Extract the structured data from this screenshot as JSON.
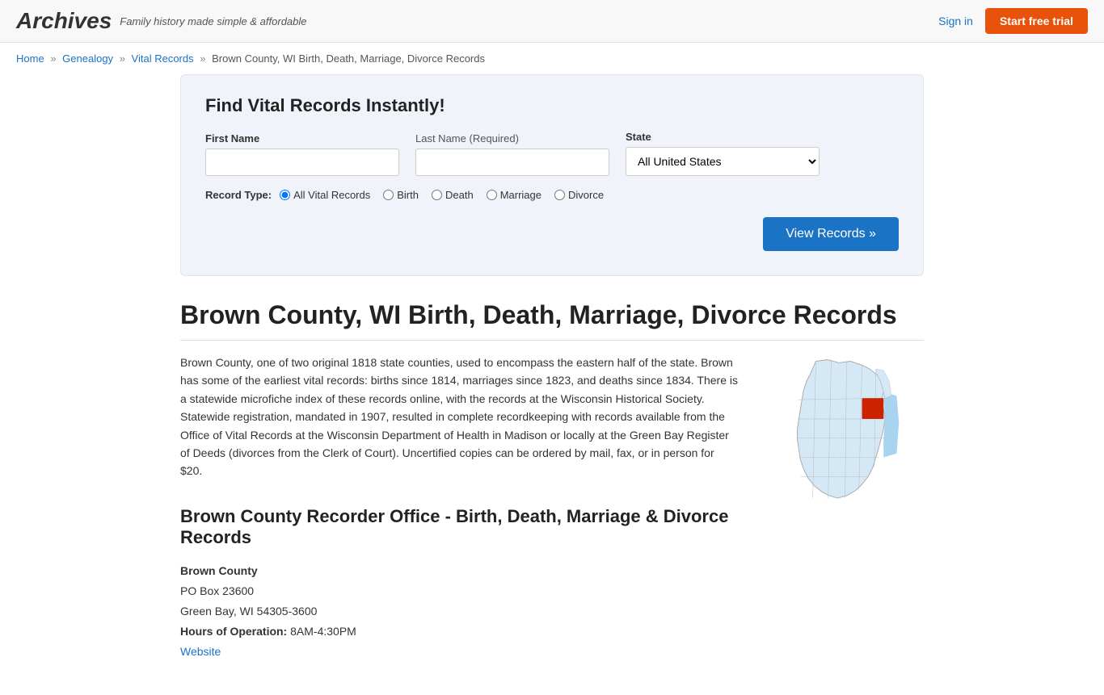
{
  "header": {
    "logo": "Archives",
    "tagline": "Family history made simple & affordable",
    "signin_label": "Sign in",
    "trial_label": "Start free trial"
  },
  "breadcrumb": {
    "home": "Home",
    "genealogy": "Genealogy",
    "vital_records": "Vital Records",
    "current": "Brown County, WI Birth, Death, Marriage, Divorce Records"
  },
  "search": {
    "title": "Find Vital Records Instantly!",
    "first_name_label": "First Name",
    "last_name_label": "Last Name",
    "last_name_required": "(Required)",
    "state_label": "State",
    "state_default": "All United States",
    "first_name_placeholder": "",
    "last_name_placeholder": "",
    "record_type_label": "Record Type:",
    "record_types": [
      "All Vital Records",
      "Birth",
      "Death",
      "Marriage",
      "Divorce"
    ],
    "view_records_btn": "View Records »"
  },
  "page": {
    "title": "Brown County, WI Birth, Death, Marriage, Divorce Records",
    "intro": "Brown County, one of two original 1818 state counties, used to encompass the eastern half of the state. Brown has some of the earliest vital records: births since 1814, marriages since 1823, and deaths since 1834. There is a statewide microfiche index of these records online, with the records at the Wisconsin Historical Society. Statewide registration, mandated in 1907, resulted in complete recordkeeping with records available from the Office of Vital Records at the Wisconsin Department of Health in Madison or locally at the Green Bay Register of Deeds (divorces from the Clerk of Court). Uncertified copies can be ordered by mail, fax, or in person for $20.",
    "recorder_title": "Brown County Recorder Office - Birth, Death, Marriage & Divorce Records",
    "office": {
      "name": "Brown County",
      "address1": "PO Box 23600",
      "address2": "Green Bay, WI 54305-3600",
      "hours_label": "Hours of Operation:",
      "hours": "8AM-4:30PM",
      "website_label": "Website"
    }
  }
}
